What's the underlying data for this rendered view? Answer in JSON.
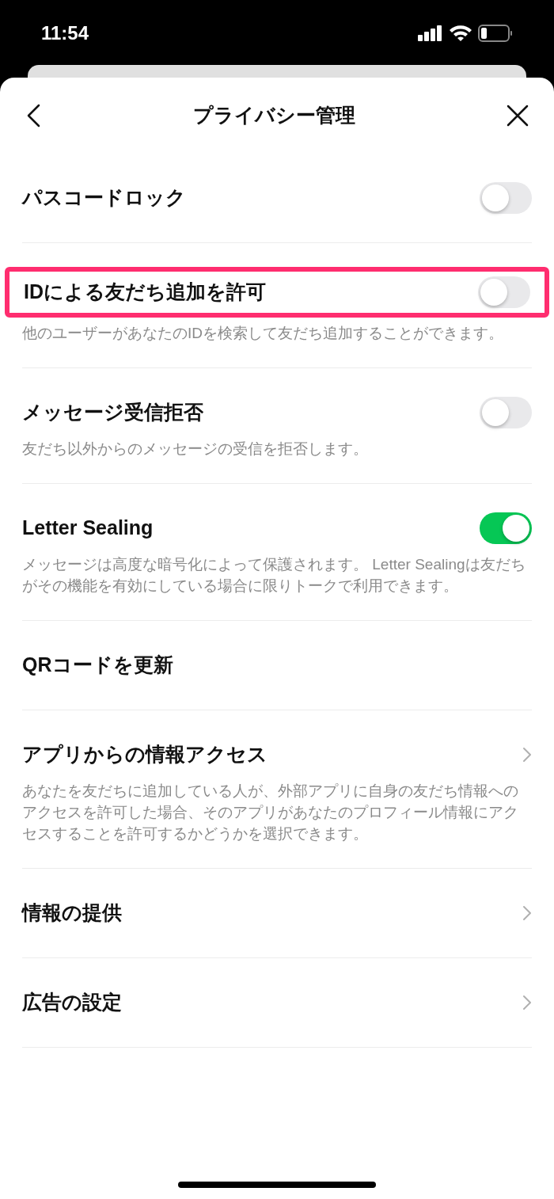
{
  "status_bar": {
    "time": "11:54"
  },
  "header": {
    "title": "プライバシー管理"
  },
  "items": [
    {
      "kind": "toggle",
      "label": "パスコードロック",
      "on": false,
      "highlighted": false
    },
    {
      "kind": "toggle",
      "label": "IDによる友だち追加を許可",
      "description": "他のユーザーがあなたのIDを検索して友だち追加することができます。",
      "on": false,
      "highlighted": true
    },
    {
      "kind": "toggle",
      "label": "メッセージ受信拒否",
      "description": "友だち以外からのメッセージの受信を拒否します。",
      "on": false,
      "highlighted": false
    },
    {
      "kind": "toggle",
      "label": "Letter Sealing",
      "description": "メッセージは高度な暗号化によって保護されます。 Letter Sealingは友だちがその機能を有効にしている場合に限りトークで利用できます。",
      "on": true,
      "highlighted": false
    },
    {
      "kind": "plain",
      "label": "QRコードを更新",
      "highlighted": false
    },
    {
      "kind": "link",
      "label": "アプリからの情報アクセス",
      "description": "あなたを友だちに追加している人が、外部アプリに自身の友だち情報へのアクセスを許可した場合、そのアプリがあなたのプロフィール情報にアクセスすることを許可するかどうかを選択できます。",
      "highlighted": false
    },
    {
      "kind": "link",
      "label": "情報の提供",
      "highlighted": false
    },
    {
      "kind": "link",
      "label": "広告の設定",
      "highlighted": false
    }
  ]
}
